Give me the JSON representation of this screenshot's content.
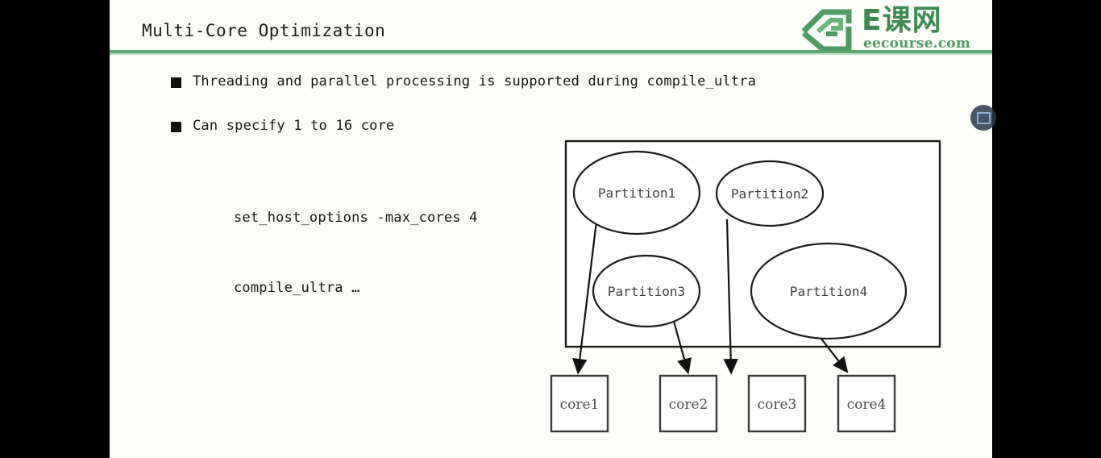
{
  "slide": {
    "title": "Multi-Core Optimization",
    "accent_color": "#5aa86a",
    "background_color": "#fdfdfa",
    "letterbox_color": "#000000"
  },
  "logo": {
    "mark_name": "eecourse-diamond-logo-mark",
    "brand_cn": "E课网",
    "domain": "eecourse.com",
    "color": "#3f8a51"
  },
  "bullets": [
    {
      "marker": "square-bullet",
      "text": "Threading and parallel processing is supported during compile_ultra"
    },
    {
      "marker": "square-bullet",
      "text": "Can specify 1 to 16 core"
    }
  ],
  "code": {
    "line1": "set_host_options -max_cores 4",
    "line2": "compile_ultra …"
  },
  "diagram": {
    "container_label": "partition-container",
    "partitions": [
      {
        "id": "partition1",
        "label": "Partition1"
      },
      {
        "id": "partition2",
        "label": "Partition2"
      },
      {
        "id": "partition3",
        "label": "Partition3"
      },
      {
        "id": "partition4",
        "label": "Partition4"
      }
    ],
    "cores": [
      {
        "id": "core1",
        "label": "core1"
      },
      {
        "id": "core2",
        "label": "core2"
      },
      {
        "id": "core3",
        "label": "core3"
      },
      {
        "id": "core4",
        "label": "core4"
      }
    ],
    "mappings": [
      {
        "from": "Partition1",
        "to": "core1"
      },
      {
        "from": "Partition3",
        "to": "core2"
      },
      {
        "from": "Partition2",
        "to": "core3"
      },
      {
        "from": "Partition4",
        "to": "core4"
      }
    ]
  },
  "overlay": {
    "corner_icon_name": "video-player-badge-icon"
  }
}
